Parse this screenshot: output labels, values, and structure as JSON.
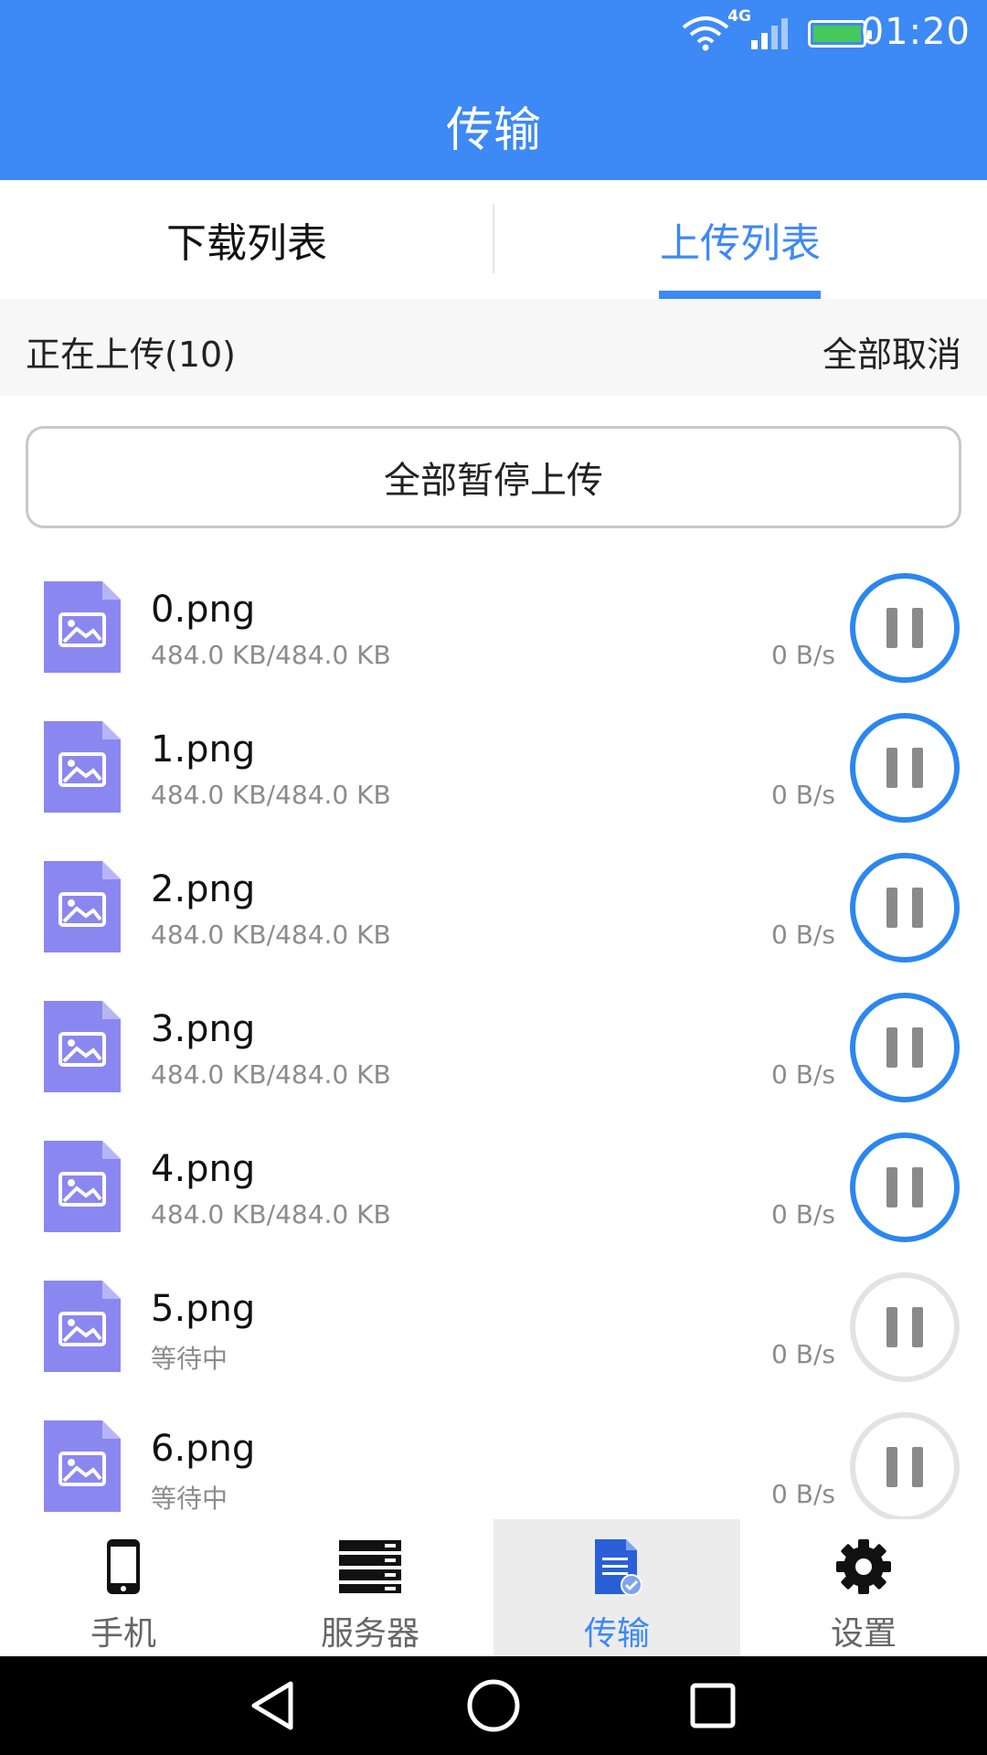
{
  "status_bar": {
    "time": "01:20",
    "network": "4G"
  },
  "header": {
    "title": "传输"
  },
  "tabs": [
    {
      "label": "下载列表",
      "active": false
    },
    {
      "label": "上传列表",
      "active": true
    }
  ],
  "section": {
    "label": "正在上传(10)",
    "cancel_all": "全部取消"
  },
  "pause_all_label": "全部暂停上传",
  "files": [
    {
      "name": "0.png",
      "status": "484.0 KB/484.0 KB",
      "speed": "0 B/s",
      "state": "active"
    },
    {
      "name": "1.png",
      "status": "484.0 KB/484.0 KB",
      "speed": "0 B/s",
      "state": "active"
    },
    {
      "name": "2.png",
      "status": "484.0 KB/484.0 KB",
      "speed": "0 B/s",
      "state": "active"
    },
    {
      "name": "3.png",
      "status": "484.0 KB/484.0 KB",
      "speed": "0 B/s",
      "state": "active"
    },
    {
      "name": "4.png",
      "status": "484.0 KB/484.0 KB",
      "speed": "0 B/s",
      "state": "active"
    },
    {
      "name": "5.png",
      "status": "等待中",
      "speed": "0 B/s",
      "state": "waiting"
    },
    {
      "name": "6.png",
      "status": "等待中",
      "speed": "0 B/s",
      "state": "waiting"
    }
  ],
  "nav": [
    {
      "label": "手机",
      "icon": "phone-icon",
      "active": false
    },
    {
      "label": "服务器",
      "icon": "server-icon",
      "active": false
    },
    {
      "label": "传输",
      "icon": "transfer-icon",
      "active": true
    },
    {
      "label": "设置",
      "icon": "gear-icon",
      "active": false
    }
  ],
  "colors": {
    "primary": "#3d89f5",
    "ring_active": "#2b87ef",
    "ring_waiting": "#e3e3e3",
    "file_icon": "#8b87f0"
  }
}
